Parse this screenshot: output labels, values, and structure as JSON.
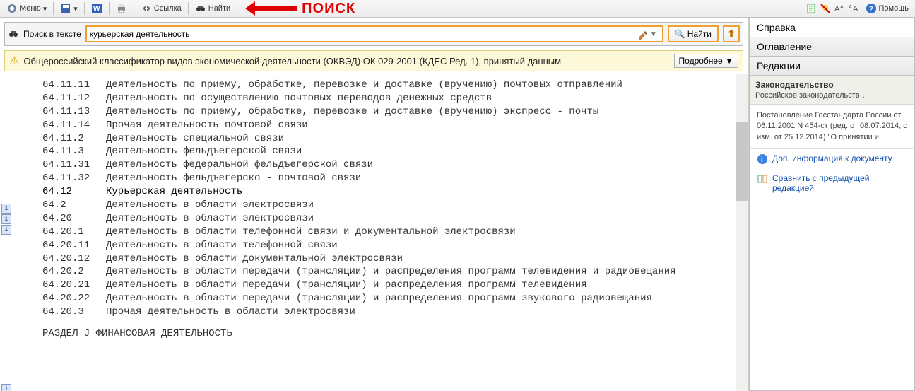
{
  "toolbar": {
    "menu": "Меню",
    "link": "Ссылка",
    "find": "Найти",
    "help": "Помощь"
  },
  "annotation": "ПОИСК",
  "search": {
    "label": "Поиск в тексте",
    "value": "курьерская деятельность",
    "dropdown": "▼",
    "find_btn": "Найти",
    "magnifier": "🔍",
    "up": "⬆"
  },
  "banner": {
    "warn": "⚠",
    "text": "Общероссийский классификатор видов экономической деятельности (ОКВЭД) ОК 029-2001 (КДЕС Ред. 1), принятый данным",
    "more": "Подробнее ▼"
  },
  "rows": [
    {
      "code": "64.11.11",
      "desc": "Деятельность по приему,  обработке, перевозке и доставке (вручению)  почтовых отправлений"
    },
    {
      "code": "64.11.12",
      "desc": "Деятельность по   осуществлению   почтовых   переводов денежных средств"
    },
    {
      "code": "64.11.13",
      "desc": "Деятельность по приему,  обработке, перевозке и доставке (вручению) экспресс - почты"
    },
    {
      "code": "64.11.14",
      "desc": "Прочая деятельность почтовой связи"
    },
    {
      "code": "64.11.2",
      "desc": "Деятельность специальной связи"
    },
    {
      "code": "64.11.3",
      "desc": "Деятельность фельдъегерской связи"
    },
    {
      "code": "64.11.31",
      "desc": "Деятельность федеральной фельдъегерской связи"
    },
    {
      "code": "64.11.32",
      "desc": "Деятельность фельдъегерско - почтовой связи"
    },
    {
      "code": "64.12",
      "desc": "Курьерская деятельность",
      "hl": true
    },
    {
      "code": "64.2",
      "desc": "Деятельность в области электросвязи"
    },
    {
      "code": "64.20",
      "desc": "Деятельность в области электросвязи"
    },
    {
      "code": "64.20.1",
      "desc": "Деятельность в области телефонной связи и документальной электросвязи"
    },
    {
      "code": "64.20.11",
      "desc": "Деятельность в области телефонной связи"
    },
    {
      "code": "64.20.12",
      "desc": "Деятельность в области документальной электросвязи"
    },
    {
      "code": "64.20.2",
      "desc": "Деятельность   в   области   передачи   (трансляции)   и распределения программ телевидения и радиовещания"
    },
    {
      "code": "64.20.21",
      "desc": "Деятельность   в   области   передачи   (трансляции)   и распределения программ телевидения"
    },
    {
      "code": "64.20.22",
      "desc": "Деятельность   в   области   передачи   (трансляции)   и распределения программ звукового радиовещания"
    },
    {
      "code": "64.20.3",
      "desc": "Прочая деятельность в области электросвязи"
    }
  ],
  "section": "РАЗДЕЛ J  ФИНАНСОВАЯ ДЕЯТЕЛЬНОСТЬ",
  "tabs": {
    "spravka": "Справка",
    "oglav": "Оглавление",
    "redak": "Редакции"
  },
  "side": {
    "law_title": "Законодательство",
    "law_sub": "Российское законодательств…",
    "note": "Постановление Госстандарта России от 06.11.2001 N 454-ст (ред. от 08.07.2014, с изм. от 25.12.2014) \"О принятии и",
    "link1": "Доп. информация к документу",
    "link2": "Сравнить с предыдущей редакцией"
  },
  "icons": {
    "i": "i"
  }
}
